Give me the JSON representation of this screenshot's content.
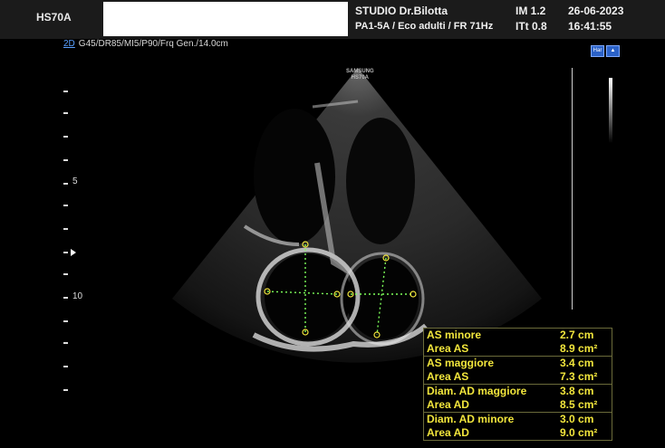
{
  "header": {
    "model": "HS70A",
    "studio": "STUDIO Dr.Bilotta",
    "probe_info": "PA1-5A / Eco adulti / FR 71Hz",
    "im": "IM  1.2",
    "itt": "ITt 0.8",
    "date": "26-06-2023",
    "time": "16:41:55"
  },
  "params": {
    "mode": "2D",
    "settings": "G45/DR85/MI5/P90/Frq Gen./14.0cm"
  },
  "scale": {
    "label_5": "5",
    "label_10": "10"
  },
  "watermark": {
    "brand": "SAMSUNG",
    "model": "HS70A"
  },
  "icons": [
    "harmonic-icon",
    "probe-icon"
  ],
  "measurements": [
    {
      "rows": [
        {
          "label": "AS minore",
          "value": "2.7 cm"
        },
        {
          "label": "Area AS",
          "value": "8.9 cm²"
        }
      ]
    },
    {
      "rows": [
        {
          "label": "AS maggiore",
          "value": "3.4 cm"
        },
        {
          "label": "Area AS",
          "value": "7.3 cm²"
        }
      ]
    },
    {
      "rows": [
        {
          "label": "Diam. AD maggiore",
          "value": "3.8 cm"
        },
        {
          "label": "Area AD",
          "value": "8.5 cm²"
        }
      ]
    },
    {
      "rows": [
        {
          "label": "Diam. AD minore",
          "value": "3.0 cm"
        },
        {
          "label": "Area AD",
          "value": "9.0 cm²"
        }
      ]
    }
  ],
  "colors": {
    "measurement_text": "#f2e63c",
    "caliper_line": "#7dff5a",
    "mode_link": "#5aa0ff"
  }
}
